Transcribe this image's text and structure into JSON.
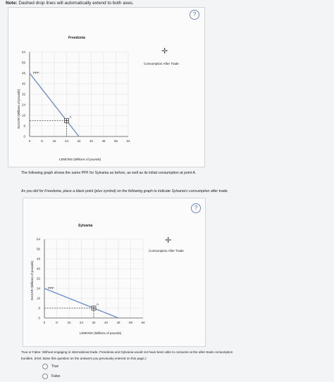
{
  "note": {
    "label": "Note:",
    "text": "Dashed drop lines will automatically extend to both axes."
  },
  "help_symbol": "?",
  "graph1": {
    "title": "Freedonia",
    "legend_label": "Consumption After Trade",
    "y_axis_label": "SUGAR (Millions of pounds)",
    "x_axis_label": "LEMONS (Millions of pounds)",
    "ppf_label": "PPF",
    "point_label": "A"
  },
  "paragraph1": "The following graph shows the same PPF for Sylvania as before, as well as its initial consumption at point A.",
  "paragraph2": "As you did for Freedonia, place a black point (plus symbol) on the following graph to indicate Sylvania's consumption after trade.",
  "graph2": {
    "title": "Sylvania",
    "legend_label": "Consumption After Trade",
    "y_axis_label": "SUGAR (Millions of pounds)",
    "x_axis_label": "LEMONS (Millions of pounds)",
    "ppf_label": "PPF",
    "point_label": "A"
  },
  "question": {
    "line1": "True or False: Without engaging in international trade, Freedonia and Sylvania would not have been able to consume at the after-trade consumption",
    "line2": "bundles. (Hint: Base this question on the answers you previously entered on this page.)"
  },
  "options": [
    "True",
    "False"
  ],
  "chart_data": [
    {
      "type": "line",
      "title": "Freedonia",
      "xlabel": "LEMONS (Millions of pounds)",
      "ylabel": "SUGAR (Millions of pounds)",
      "xlim": [
        0,
        64
      ],
      "ylim": [
        0,
        64
      ],
      "x_ticks": [
        0,
        8,
        16,
        24,
        32,
        40,
        48,
        56,
        64
      ],
      "y_ticks": [
        0,
        8,
        16,
        24,
        32,
        40,
        48,
        56,
        64
      ],
      "grid": true,
      "series": [
        {
          "name": "PPF",
          "x": [
            0,
            32
          ],
          "y": [
            48,
            0
          ]
        },
        {
          "name": "A",
          "x": [
            24
          ],
          "y": [
            12
          ]
        }
      ],
      "legend": "top-right"
    },
    {
      "type": "line",
      "title": "Sylvania",
      "xlabel": "LEMONS (Millions of pounds)",
      "ylabel": "SUGAR (Millions of pounds)",
      "xlim": [
        0,
        64
      ],
      "ylim": [
        0,
        64
      ],
      "x_ticks": [
        0,
        8,
        16,
        24,
        32,
        40,
        48,
        56,
        64
      ],
      "y_ticks": [
        0,
        8,
        16,
        24,
        32,
        40,
        48,
        56,
        64
      ],
      "grid": true,
      "series": [
        {
          "name": "PPF",
          "x": [
            0,
            48
          ],
          "y": [
            24,
            0
          ]
        },
        {
          "name": "A",
          "x": [
            32
          ],
          "y": [
            8
          ]
        }
      ],
      "legend": "top-right"
    }
  ]
}
